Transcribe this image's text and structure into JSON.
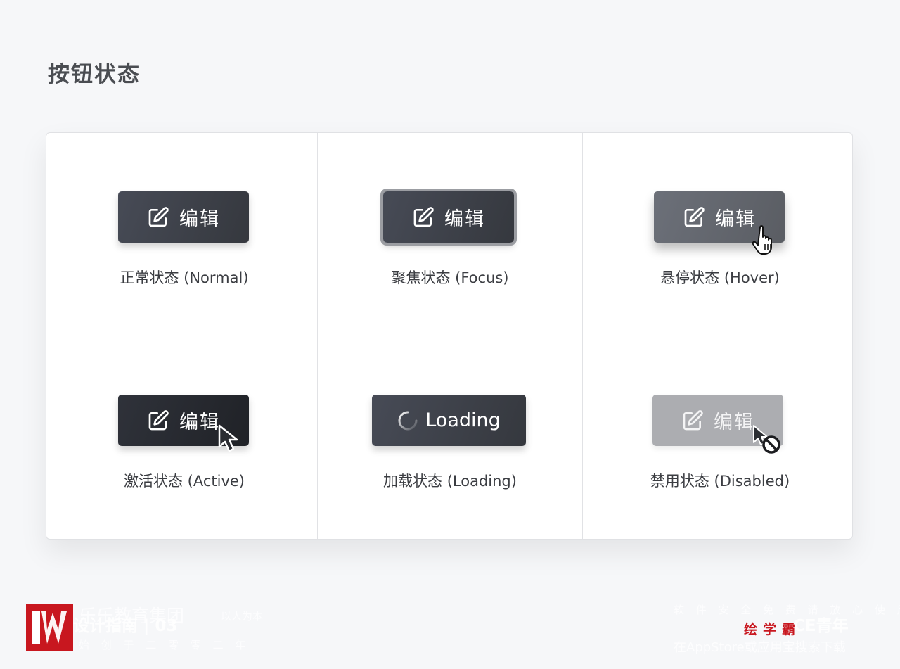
{
  "page": {
    "title": "按钮状态"
  },
  "states": [
    {
      "key": "normal",
      "button_label": "编辑",
      "caption": "正常状态 (Normal)"
    },
    {
      "key": "focus",
      "button_label": "编辑",
      "caption": "聚焦状态 (Focus)"
    },
    {
      "key": "hover",
      "button_label": "编辑",
      "caption": "悬停状态 (Hover)"
    },
    {
      "key": "active",
      "button_label": "编辑",
      "caption": "激活状态 (Active)"
    },
    {
      "key": "loading",
      "button_label": "Loading",
      "caption": "加载状态 (Loading)"
    },
    {
      "key": "disabled",
      "button_label": "编辑",
      "caption": "禁用状态 (Disabled)"
    }
  ],
  "icons": {
    "edit": "edit-icon",
    "hand": "hand-pointer-icon",
    "arrow": "arrow-cursor-icon",
    "spinner": "loading-spinner-icon",
    "not_allowed": "not-allowed-icon"
  },
  "footer": {
    "left_line1": "乐乐教育集团",
    "left_tag": "以人为本",
    "left_line2": "设计指南 | 03",
    "left_line3": "始 创 于 二 零 零 二 年",
    "right_line1": "软 件 安 全 免 费 请 放 心 使 用",
    "right_brand": "绘学霸",
    "right_year": "CE青年",
    "right_line3": "在AppStore或应用宝搜索下载"
  },
  "colors": {
    "background": "#f6f7f9",
    "button_dark": "#3f434b",
    "button_hover": "#63666d",
    "button_disabled": "#acadb1",
    "focus_ring": "#9b9da2",
    "brand_red": "#c8171f"
  }
}
